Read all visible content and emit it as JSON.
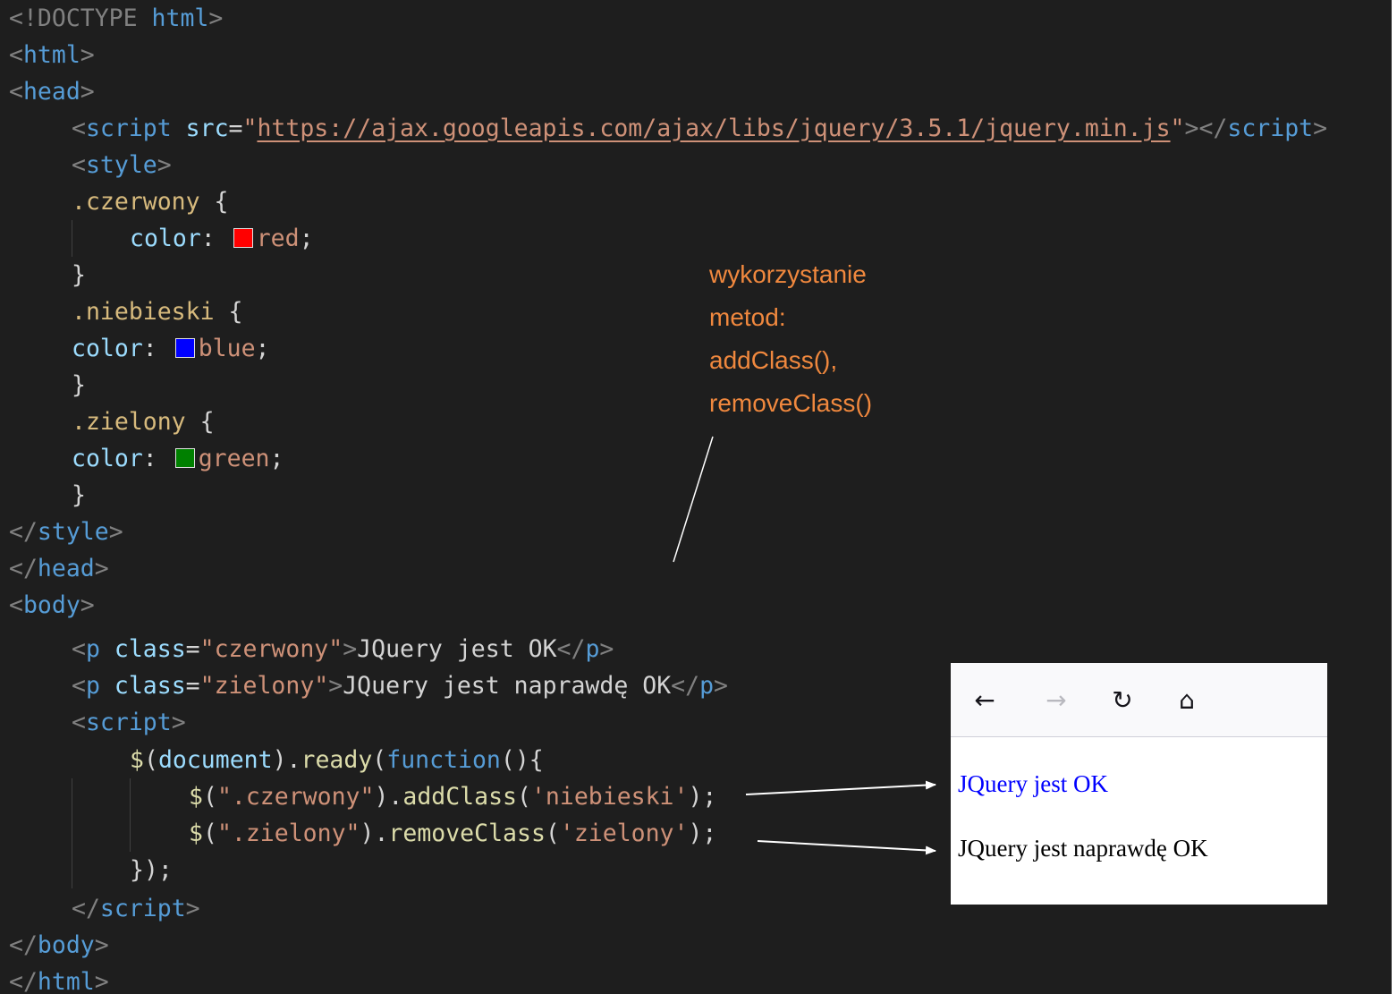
{
  "code": {
    "l1": {
      "open": "<!DOCTYPE ",
      "kw": "html",
      "close": ">"
    },
    "l2": {
      "open": "<",
      "tag": "html",
      "close": ">"
    },
    "l3": {
      "open": "<",
      "tag": "head",
      "close": ">"
    },
    "l4": {
      "open": "<",
      "tag": "script",
      "attr": " src",
      "eq": "=",
      "val_q1": "\"",
      "url": "https://ajax.googleapis.com/ajax/libs/jquery/3.5.1/jquery.min.js",
      "val_q2": "\"",
      "mid": "></",
      "tag2": "script",
      "close": ">"
    },
    "l5": {
      "open": "<",
      "tag": "style",
      "close": ">"
    },
    "l6": {
      "sel": ".czerwony",
      "brace": " {"
    },
    "l7": {
      "prop": "color",
      "colon": ": ",
      "val": "red",
      "semi": ";"
    },
    "l8": {
      "brace": "}"
    },
    "l9": {
      "sel": ".niebieski",
      "brace": " {"
    },
    "l10": {
      "prop": "color",
      "colon": ": ",
      "val": "blue",
      "semi": ";"
    },
    "l11": {
      "brace": "}"
    },
    "l12": {
      "sel": ".zielony",
      "brace": " {"
    },
    "l13": {
      "prop": "color",
      "colon": ": ",
      "val": "green",
      "semi": ";"
    },
    "l14": {
      "brace": "}"
    },
    "l15": {
      "open": "</",
      "tag": "style",
      "close": ">"
    },
    "l16": {
      "open": "</",
      "tag": "head",
      "close": ">"
    },
    "l17": {
      "open": "<",
      "tag": "body",
      "close": ">"
    },
    "l18": {
      "open": "<",
      "tag": "p",
      "attr": " class",
      "eq": "=",
      "val": "\"czerwony\"",
      "gt": ">",
      "text": "JQuery jest OK",
      "end_open": "</",
      "end_tag": "p",
      "end_close": ">"
    },
    "l19": {
      "open": "<",
      "tag": "p",
      "attr": " class",
      "eq": "=",
      "val": "\"zielony\"",
      "gt": ">",
      "text": "JQuery jest naprawdę OK",
      "end_open": "</",
      "end_tag": "p",
      "end_close": ">"
    },
    "l20": {
      "open": "<",
      "tag": "script",
      "close": ">"
    },
    "l21": {
      "dollar": "$",
      "p1": "(",
      "var": "document",
      "p2": ").",
      "fn": "ready",
      "p3": "(",
      "kw": "function",
      "p4": "(){"
    },
    "l22": {
      "dollar": "$",
      "p1": "(",
      "str": "\".czerwony\"",
      "p2": ").",
      "fn": "addClass",
      "p3": "(",
      "str2": "'niebieski'",
      "p4": ");"
    },
    "l23": {
      "dollar": "$",
      "p1": "(",
      "str": "\".zielony\"",
      "p2": ").",
      "fn": "removeClass",
      "p3": "(",
      "str2": "'zielony'",
      "p4": ");"
    },
    "l24": {
      "text": "});"
    },
    "l25": {
      "open": "</",
      "tag": "script",
      "close": ">"
    },
    "l26": {
      "open": "</",
      "tag": "body",
      "close": ">"
    },
    "l27": {
      "open": "</",
      "tag": "html",
      "close": ">"
    }
  },
  "colors": {
    "red": "#ff0000",
    "blue": "#0000ff",
    "green": "#008000",
    "annotation": "#f0883e",
    "editor_bg": "#1e1e1e"
  },
  "annotation": {
    "lines": [
      "wykorzystanie",
      "metod:",
      "addClass(),",
      "removeClass()"
    ]
  },
  "preview": {
    "back_icon": "←",
    "forward_icon": "→",
    "reload_icon": "↻",
    "home_icon": "⌂",
    "line1": "JQuery jest OK",
    "line2": "JQuery jest naprawdę OK"
  }
}
